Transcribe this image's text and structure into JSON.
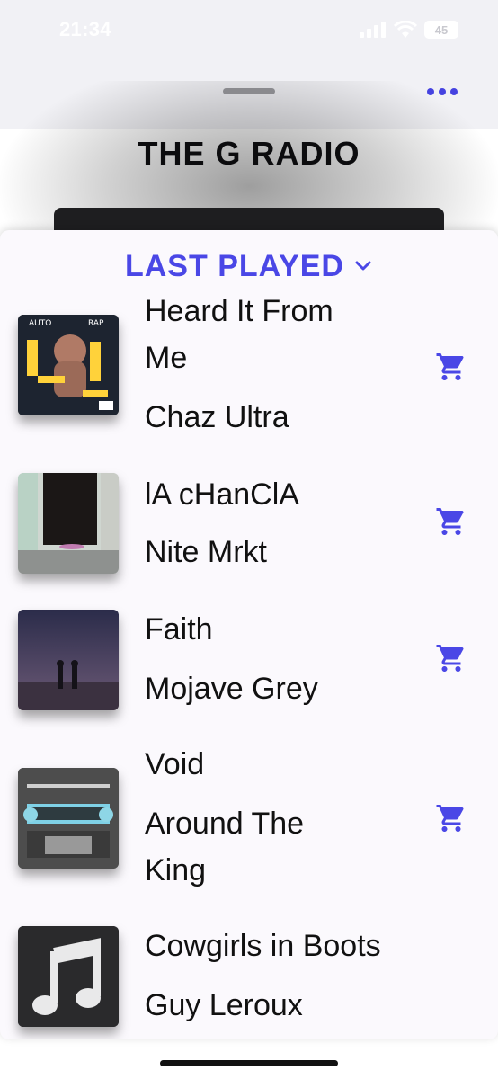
{
  "status_bar": {
    "time": "21:34",
    "battery": "45"
  },
  "station": {
    "title": "THE G RADIO"
  },
  "sheet": {
    "title": "LAST PLAYED"
  },
  "tracks": [
    {
      "title_line1": "Heard It From",
      "title_line2": "Me",
      "artist_line1": "Chaz Ultra",
      "artist_line2": "",
      "cover": "auto-rap-cover"
    },
    {
      "title_line1": "lA cHanClA",
      "title_line2": "",
      "artist_line1": "Nite Mrkt",
      "artist_line2": "",
      "cover": "doorway-cover"
    },
    {
      "title_line1": "Faith",
      "title_line2": "",
      "artist_line1": "Mojave Grey",
      "artist_line2": "",
      "cover": "desert-night-cover"
    },
    {
      "title_line1": "Void",
      "title_line2": "",
      "artist_line1": "Around The",
      "artist_line2": "King",
      "cover": "slowriter-cover"
    },
    {
      "title_line1": "Cowgirls in Boots",
      "title_line2": "",
      "artist_line1": "Guy Leroux",
      "artist_line2": "",
      "cover": "music-note-placeholder"
    }
  ],
  "colors": {
    "accent": "#4a47e6"
  }
}
